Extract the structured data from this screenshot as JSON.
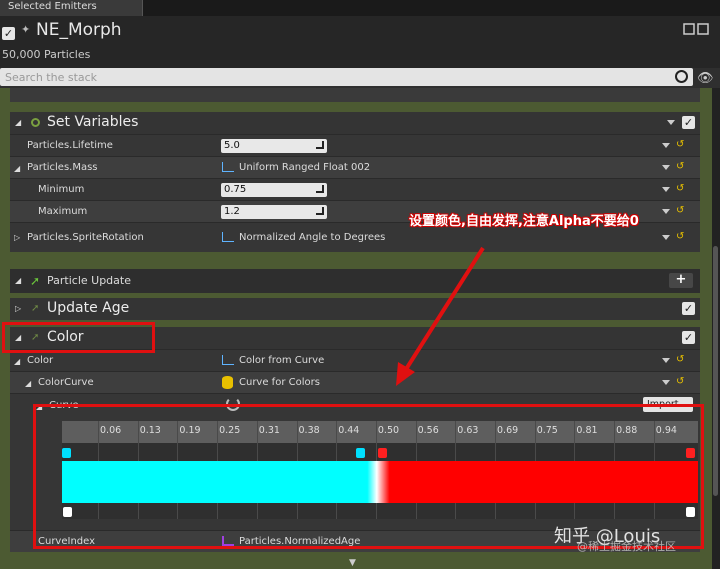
{
  "tab": {
    "label": "Selected Emitters"
  },
  "emitter": {
    "name": "NE_Morph",
    "count": "50,000 Particles"
  },
  "search": {
    "placeholder": "Search the stack"
  },
  "set_variables": {
    "title": "Set Variables",
    "lifetime_label": "Particles.Lifetime",
    "lifetime_value": "5.0",
    "mass_label": "Particles.Mass",
    "mass_value": "Uniform Ranged Float 002",
    "min_label": "Minimum",
    "min_value": "0.75",
    "max_label": "Maximum",
    "max_value": "1.2",
    "rot_label": "Particles.SpriteRotation",
    "rot_value": "Normalized Angle to Degrees"
  },
  "particle_update": {
    "title": "Particle Update",
    "add": "+"
  },
  "update_age": {
    "title": "Update Age"
  },
  "color_module": {
    "title": "Color",
    "color_label": "Color",
    "color_value": "Color from Curve",
    "curve_label": "ColorCurve",
    "curve_value": "Curve for Colors",
    "curve_sub_label": "Curve",
    "import_label": "Import",
    "index_label": "CurveIndex",
    "index_value": "Particles.NormalizedAge"
  },
  "curve_ruler": [
    "0.06",
    "0.13",
    "0.19",
    "0.25",
    "0.31",
    "0.38",
    "0.44",
    "0.50",
    "0.56",
    "0.63",
    "0.69",
    "0.75",
    "0.81",
    "0.88",
    "0.94"
  ],
  "gradient": {
    "left_color": "#00ffff",
    "right_color": "#ff0000",
    "split_fraction": 0.5
  },
  "annotation": "设置颜色,自由发挥,注意Alpha不要给0",
  "watermark": {
    "main": "知乎 @Louis",
    "sub": "@稀土掘金技术社区"
  },
  "colors": {
    "stack_bg": "#4c5a32",
    "highlight": "#e01010"
  }
}
